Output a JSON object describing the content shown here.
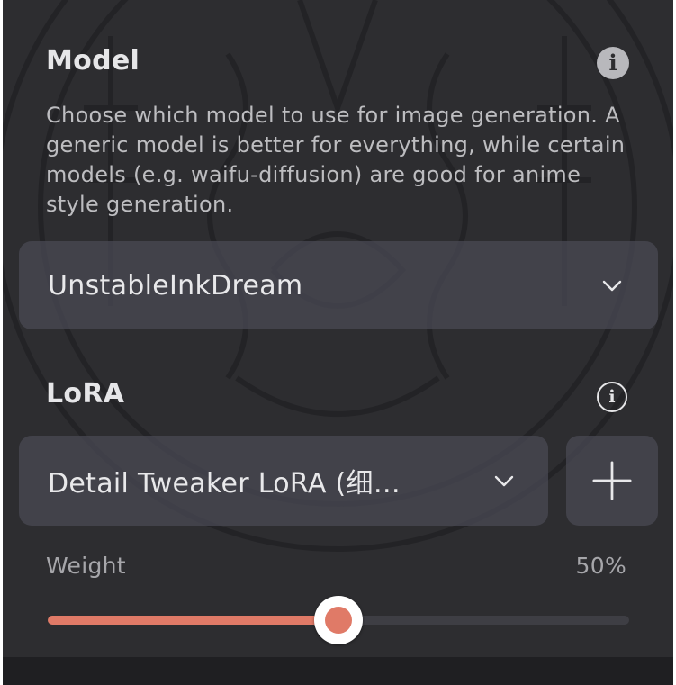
{
  "colors": {
    "background": "#2d2d30",
    "accent": "#e07a67",
    "control": "#484852",
    "text": "#e6e6e8",
    "muted_text": "#a6a6aa"
  },
  "model": {
    "title": "Model",
    "info_icon": "info-filled-icon",
    "description": "Choose which model to use for image generation. A generic model is better for everything, while certain models (e.g. waifu-diffusion) are good for anime style generation.",
    "selected": "UnstableInkDream",
    "dropdown_icon": "chevron-down-icon"
  },
  "lora": {
    "title": "LoRA",
    "info_icon": "info-outline-icon",
    "selected": "Detail Tweaker LoRA (细…",
    "dropdown_icon": "chevron-down-icon",
    "add_icon": "plus-icon",
    "weight_label": "Weight",
    "weight_display": "50%",
    "weight_fraction": 0.5
  }
}
